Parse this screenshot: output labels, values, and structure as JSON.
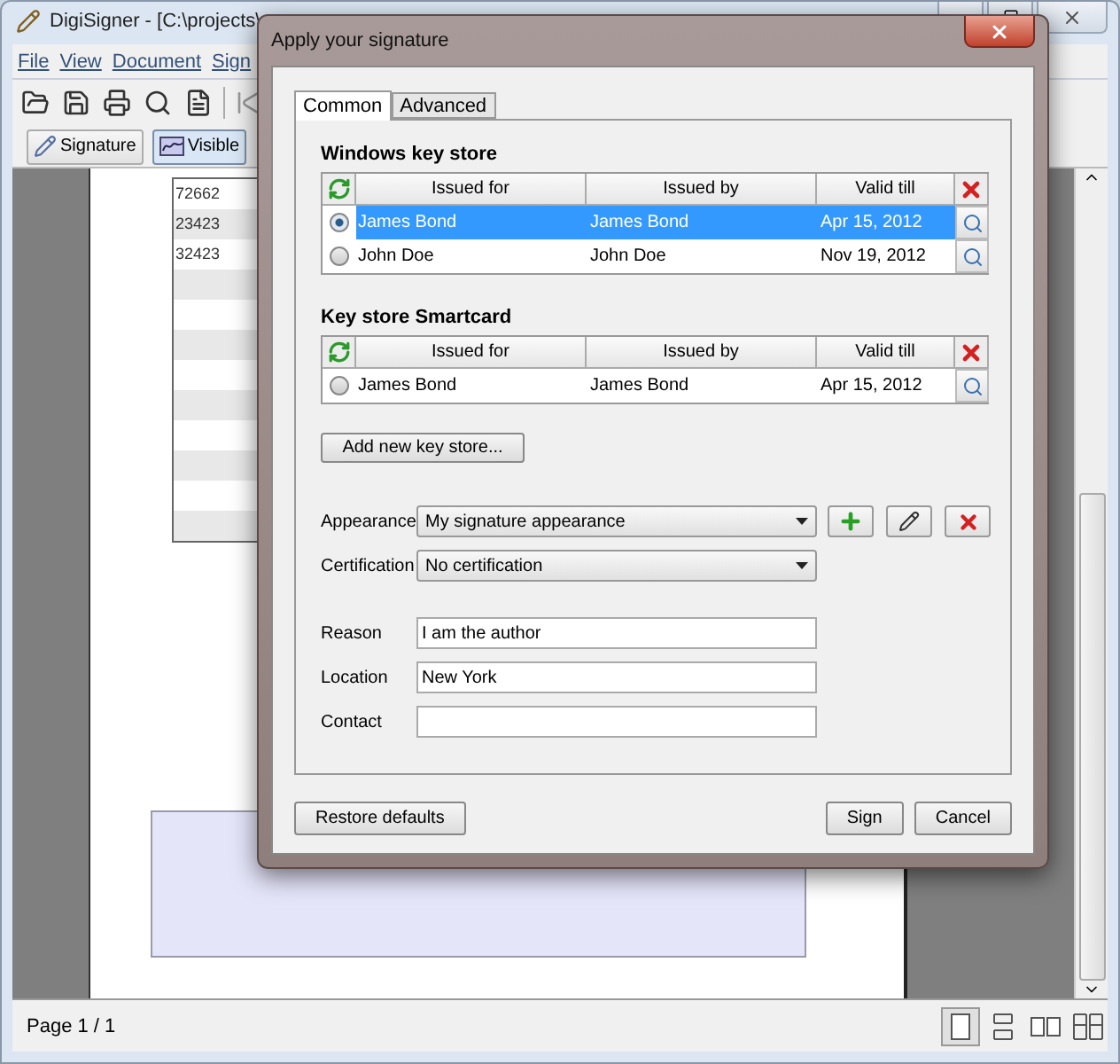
{
  "main_window": {
    "title": "DigiSigner - [C:\\projects\\",
    "menu": [
      "File",
      "View",
      "Document",
      "Sign"
    ],
    "toolbar_buttons": [
      {
        "kind": "signature",
        "label": "Signature",
        "selected": false
      },
      {
        "kind": "visible",
        "label": "Visible",
        "selected": true
      }
    ],
    "document": {
      "table_rows": [
        "72662",
        "23423",
        "32423"
      ]
    },
    "status_bar": {
      "page": "Page 1 / 1",
      "view_modes": [
        {
          "kind": "single",
          "selected": true
        },
        {
          "kind": "continuous",
          "selected": false
        },
        {
          "kind": "facing",
          "selected": false
        },
        {
          "kind": "facing_continuous",
          "selected": false
        }
      ]
    }
  },
  "dialog": {
    "title": "Apply your signature",
    "tabs": [
      {
        "label": "Common",
        "selected": true
      },
      {
        "label": "Advanced",
        "selected": false
      }
    ],
    "key_stores": [
      {
        "title": "Windows key store",
        "columns": [
          "Issued for",
          "Issued by",
          "Valid till"
        ],
        "rows": [
          {
            "issued_for": "James Bond",
            "issued_by": "James Bond",
            "valid_till": "Apr 15, 2012",
            "selected": true
          },
          {
            "issued_for": "John Doe",
            "issued_by": "John Doe",
            "valid_till": "Nov 19, 2012",
            "selected": false
          }
        ]
      },
      {
        "title": "Key store Smartcard",
        "columns": [
          "Issued for",
          "Issued by",
          "Valid till"
        ],
        "rows": [
          {
            "issued_for": "James Bond",
            "issued_by": "James Bond",
            "valid_till": "Apr 15, 2012",
            "selected": false
          }
        ]
      }
    ],
    "add_button": "Add new key store...",
    "dropdowns": [
      {
        "label": "Appearance",
        "value": "My signature appearance",
        "kind": "with_actions"
      },
      {
        "label": "Certification",
        "value": "No certification",
        "kind": "plain"
      }
    ],
    "fields": [
      {
        "label": "Reason",
        "value": "I am the author"
      },
      {
        "label": "Location",
        "value": "New York"
      },
      {
        "label": "Contact"
      }
    ],
    "left_buttons": [
      "Restore defaults"
    ],
    "right_buttons": [
      "Sign",
      "Cancel"
    ]
  }
}
